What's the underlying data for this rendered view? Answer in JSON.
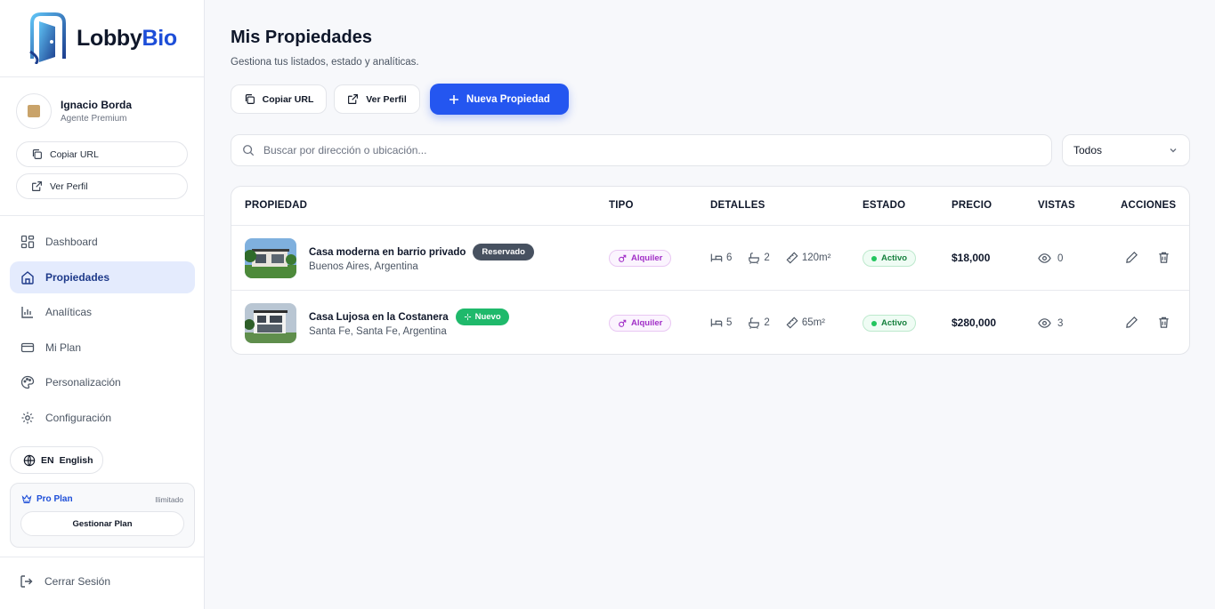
{
  "brand": {
    "name_part1": "Lobby",
    "name_part2": "Bio",
    "accent": "#1d4ed8"
  },
  "profile": {
    "name": "Ignacio Borda",
    "role": "Agente Premium"
  },
  "sidebar": {
    "copy_url": "Copiar URL",
    "view_profile": "Ver Perfil",
    "nav": [
      {
        "label": "Dashboard",
        "icon": "dashboard-icon"
      },
      {
        "label": "Propiedades",
        "icon": "home-icon",
        "active": true
      },
      {
        "label": "Analíticas",
        "icon": "bar-chart-icon"
      },
      {
        "label": "Mi Plan",
        "icon": "credit-card-icon"
      },
      {
        "label": "Personalización",
        "icon": "palette-icon"
      },
      {
        "label": "Configuración",
        "icon": "gear-icon"
      }
    ],
    "language": {
      "code": "EN",
      "name": "English"
    },
    "plan": {
      "name": "Pro Plan",
      "limit": "Ilimitado",
      "manage": "Gestionar Plan"
    },
    "logout": "Cerrar Sesión"
  },
  "main": {
    "title": "Mis Propiedades",
    "subtitle": "Gestiona tus listados, estado y analíticas.",
    "copy_url": "Copiar URL",
    "view_profile": "Ver Perfil",
    "new_property": "Nueva Propiedad",
    "search_placeholder": "Buscar por dirección o ubicación...",
    "filter": "Todos"
  },
  "table": {
    "headers": [
      "PROPIEDAD",
      "TIPO",
      "DETALLES",
      "ESTADO",
      "PRECIO",
      "VISTAS",
      "ACCIONES"
    ],
    "rows": [
      {
        "title": "Casa moderna en barrio privado",
        "badge": "Reservado",
        "location": "Buenos Aires, Argentina",
        "type": "Alquiler",
        "beds": "6",
        "baths": "2",
        "area": "120m²",
        "status": "Activo",
        "price": "$18,000",
        "views": "0"
      },
      {
        "title": "Casa Lujosa en la Costanera",
        "badge": "Nuevo",
        "location": "Santa Fe, Santa Fe, Argentina",
        "type": "Alquiler",
        "beds": "5",
        "baths": "2",
        "area": "65m²",
        "status": "Activo",
        "price": "$280,000",
        "views": "3"
      }
    ]
  },
  "colors": {
    "primary": "#2456f0",
    "success": "#1fb96b",
    "tipo": "#a12fc7",
    "reserved": "#475160"
  }
}
